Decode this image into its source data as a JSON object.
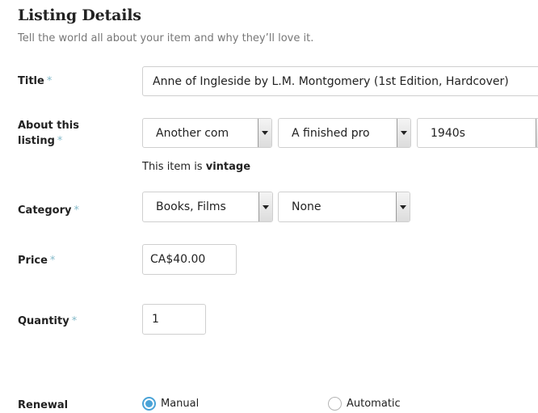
{
  "header": {
    "title": "Listing Details",
    "subtitle": "Tell the world all about your item and why they’ll love it."
  },
  "required_mark": "*",
  "title_field": {
    "label": "Title",
    "value": "Anne of Ingleside by L.M. Montgomery (1st Edition, Hardcover)"
  },
  "about": {
    "label_line1": "About this",
    "label_line2": "listing",
    "who_made": "Another com",
    "what_is_it": "A finished pro",
    "when_made": "1940s",
    "vintage_prefix": "This item is",
    "vintage_word": "vintage"
  },
  "category": {
    "label": "Category",
    "primary": "Books, Films",
    "secondary": "None"
  },
  "price": {
    "label": "Price",
    "value": "CA$40.00"
  },
  "quantity": {
    "label": "Quantity",
    "value": "1"
  },
  "renewal": {
    "label": "Renewal",
    "options": [
      {
        "label": "Manual",
        "checked": true
      },
      {
        "label": "Automatic",
        "checked": false
      }
    ]
  },
  "colors": {
    "required": "#84b9c9",
    "radio_accent": "#4aa3d7"
  }
}
